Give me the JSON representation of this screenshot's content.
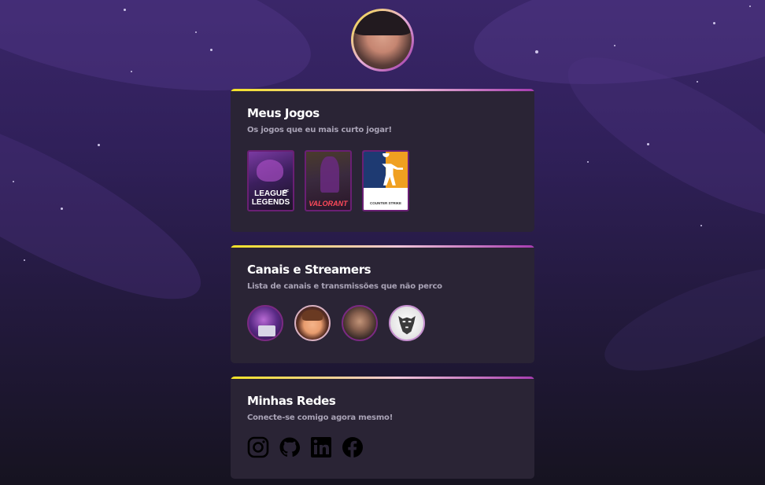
{
  "profile": {
    "avatar_icon": "profile-photo"
  },
  "cards": {
    "games": {
      "title": "Meus Jogos",
      "subtitle": "Os jogos que eu mais curto jogar!",
      "items": [
        {
          "name": "league-of-legends",
          "line1": "LEAGUE",
          "line2": "LEGENDS",
          "small": "OF"
        },
        {
          "name": "valorant",
          "line1": "VALORANT"
        },
        {
          "name": "counter-strike",
          "line1": "COUNTER STRIKE"
        }
      ]
    },
    "streamers": {
      "title": "Canais e Streamers",
      "subtitle": "Lista de canais e transmissões que não perco"
    },
    "social": {
      "title": "Minhas Redes",
      "subtitle": "Conecte-se comigo agora mesmo!",
      "icons": [
        "instagram-icon",
        "github-icon",
        "linkedin-icon",
        "facebook-icon"
      ]
    }
  },
  "colors": {
    "card_bg": "#2a2435",
    "accent_start": "#f3e226",
    "accent_mid": "#f0c6d8",
    "accent_end": "#a63cb0"
  }
}
